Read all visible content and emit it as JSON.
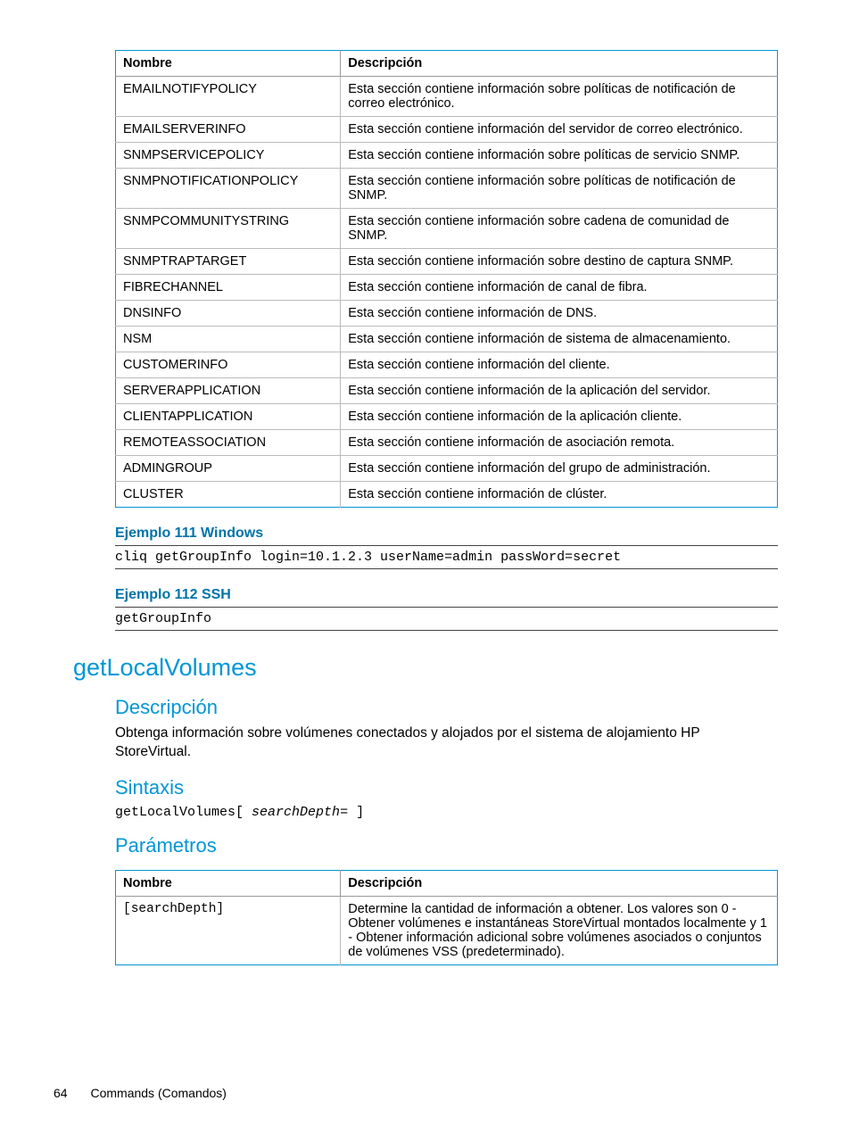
{
  "table1": {
    "headers": {
      "name": "Nombre",
      "desc": "Descripción"
    },
    "rows": [
      {
        "name": "EMAILNOTIFYPOLICY",
        "desc": "Esta sección contiene información sobre políticas de notificación de correo electrónico."
      },
      {
        "name": "EMAILSERVERINFO",
        "desc": "Esta sección contiene información del servidor de correo electrónico."
      },
      {
        "name": "SNMPSERVICEPOLICY",
        "desc": "Esta sección contiene información sobre políticas de servicio SNMP."
      },
      {
        "name": "SNMPNOTIFICATIONPOLICY",
        "desc": "Esta sección contiene información sobre políticas de notificación de SNMP."
      },
      {
        "name": "SNMPCOMMUNITYSTRING",
        "desc": "Esta sección contiene información sobre cadena de comunidad de SNMP."
      },
      {
        "name": "SNMPTRAPTARGET",
        "desc": "Esta sección contiene información sobre destino de captura SNMP."
      },
      {
        "name": "FIBRECHANNEL",
        "desc": "Esta sección contiene información de canal de fibra."
      },
      {
        "name": "DNSINFO",
        "desc": "Esta sección contiene información de DNS."
      },
      {
        "name": "NSM",
        "desc": "Esta sección contiene información de sistema de almacenamiento."
      },
      {
        "name": "CUSTOMERINFO",
        "desc": "Esta sección contiene información del cliente."
      },
      {
        "name": "SERVERAPPLICATION",
        "desc": "Esta sección contiene información de la aplicación del servidor."
      },
      {
        "name": "CLIENTAPPLICATION",
        "desc": "Esta sección contiene información de la aplicación cliente."
      },
      {
        "name": "REMOTEASSOCIATION",
        "desc": "Esta sección contiene información de asociación remota."
      },
      {
        "name": "ADMINGROUP",
        "desc": "Esta sección contiene información del grupo de administración."
      },
      {
        "name": "CLUSTER",
        "desc": "Esta sección contiene información de clúster."
      }
    ]
  },
  "example1": {
    "heading": "Ejemplo 111 Windows",
    "code": "cliq getGroupInfo login=10.1.2.3 userName=admin passWord=secret"
  },
  "example2": {
    "heading": "Ejemplo 112 SSH",
    "code": "getGroupInfo"
  },
  "section": {
    "title": "getLocalVolumes",
    "desc_heading": "Descripción",
    "desc_text": "Obtenga información sobre volúmenes conectados y alojados por el sistema de alojamiento HP StoreVirtual.",
    "syntax_heading": "Sintaxis",
    "syntax_cmd": "getLocalVolumes",
    "syntax_openbr": "[ ",
    "syntax_param": "searchDepth=",
    "syntax_closebr": " ]",
    "params_heading": "Parámetros"
  },
  "table2": {
    "headers": {
      "name": "Nombre",
      "desc": "Descripción"
    },
    "rows": [
      {
        "name": "[searchDepth]",
        "desc": "Determine la cantidad de información a obtener. Los valores son 0 - Obtener volúmenes e instantáneas StoreVirtual montados localmente y 1 - Obtener información adicional sobre volúmenes asociados o conjuntos de volúmenes VSS (predeterminado)."
      }
    ]
  },
  "footer": {
    "page": "64",
    "title": "Commands (Comandos)"
  }
}
